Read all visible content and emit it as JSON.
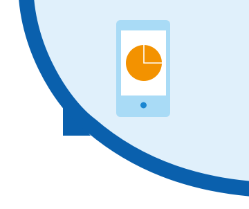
{
  "illustration": {
    "description_icon": "mobile-phone-pie-chart-icon",
    "colors": {
      "background": "#ffffff",
      "bubble_fill": "#e0f0fb",
      "bubble_stroke": "#0a60ad",
      "phone_body": "#a9dbf6",
      "phone_screen": "#ffffff",
      "pie_fill": "#f39200",
      "pie_slice_line": "#ffffff",
      "home_button": "#1a86d1"
    }
  }
}
